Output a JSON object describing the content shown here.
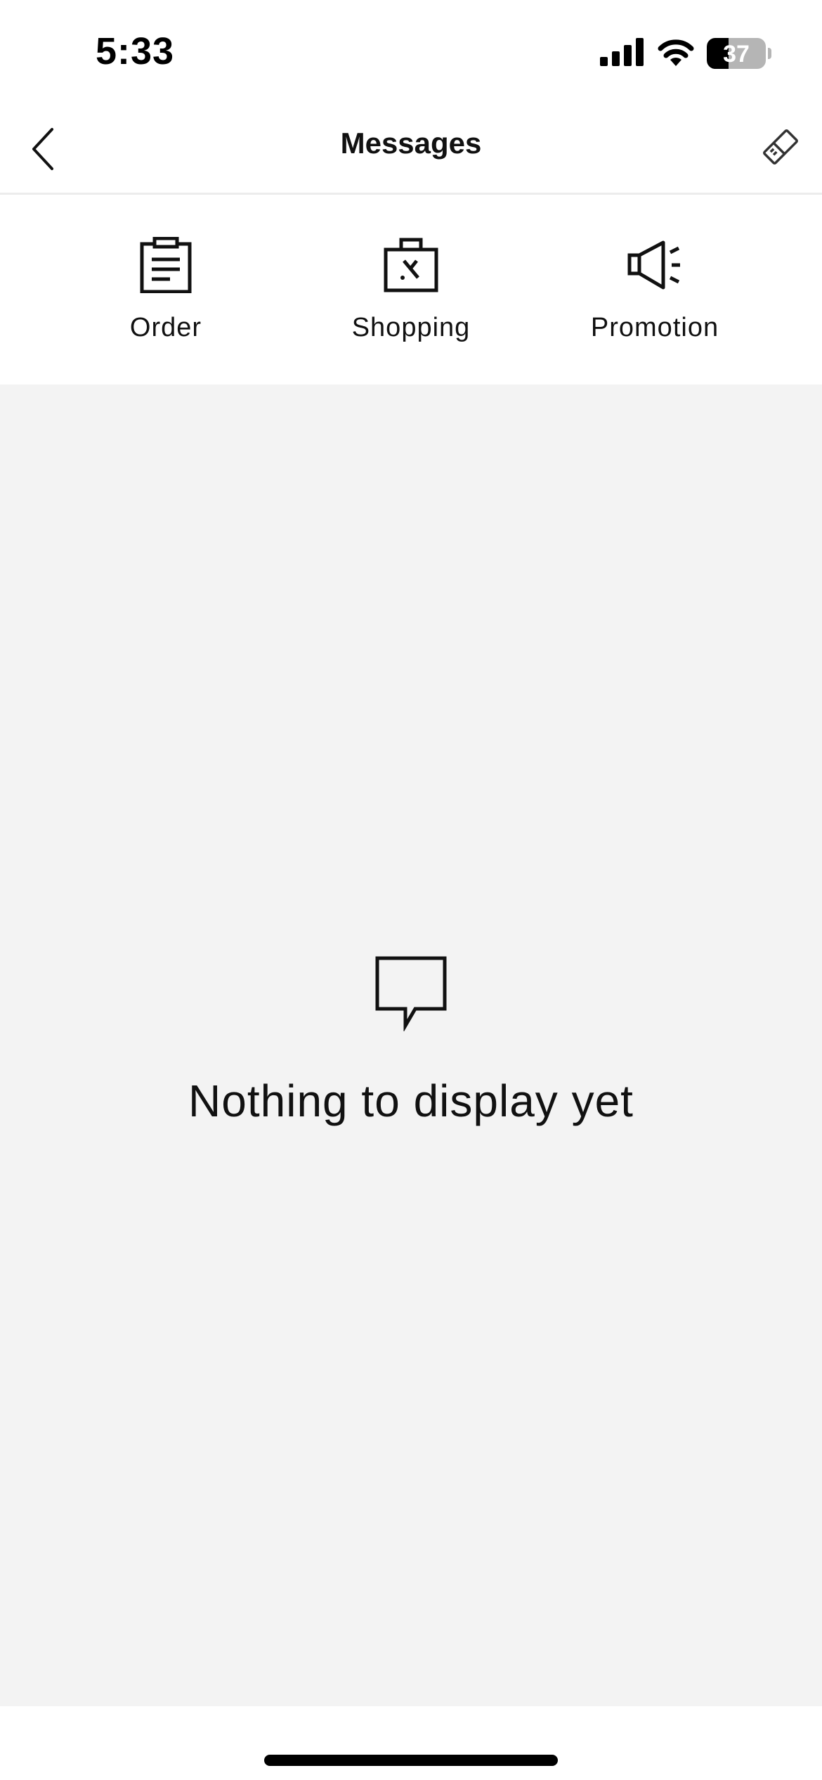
{
  "status_bar": {
    "time": "5:33",
    "battery_level": "37",
    "battery_fraction": 0.37,
    "signal_icon": "cellular-signal-icon",
    "wifi_icon": "wifi-icon"
  },
  "nav": {
    "title": "Messages",
    "back_icon": "chevron-left-icon",
    "clear_icon": "eraser-icon"
  },
  "categories": [
    {
      "label": "Order",
      "icon": "clipboard-icon"
    },
    {
      "label": "Shopping",
      "icon": "shopping-bag-icon"
    },
    {
      "label": "Promotion",
      "icon": "megaphone-icon"
    }
  ],
  "empty_state": {
    "icon": "speech-bubble-icon",
    "message": "Nothing to display yet"
  },
  "colors": {
    "background": "#ffffff",
    "content_background": "#f3f3f3",
    "text": "#111111",
    "divider": "#ececec"
  }
}
